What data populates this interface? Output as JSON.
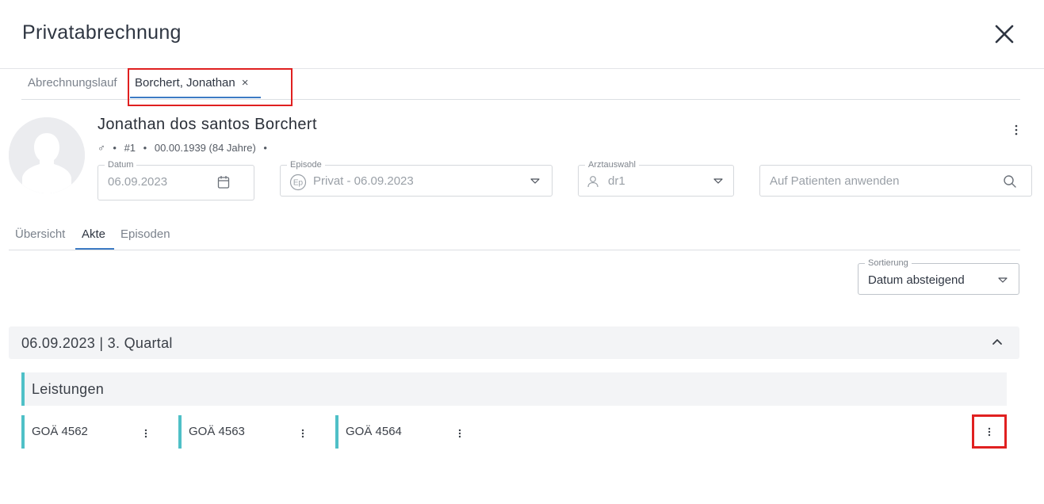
{
  "dialog": {
    "title": "Privatabrechnung"
  },
  "top_tabs": [
    {
      "label": "Abrechnungslauf"
    },
    {
      "label": "Borchert, Jonathan",
      "close": "×"
    }
  ],
  "patient": {
    "name": "Jonathan dos santos Borchert",
    "gender_symbol": "♂",
    "sep": "•",
    "number": "#1",
    "birth": "00.00.1939 (84 Jahre)"
  },
  "fields": {
    "datum": {
      "label": "Datum",
      "value": "06.09.2023",
      "icon": "calendar-icon"
    },
    "episode": {
      "label": "Episode",
      "badge": "Ep",
      "value": "Privat - 06.09.2023",
      "icon": "chevron-down-icon"
    },
    "arzt": {
      "label": "Arztauswahl",
      "value": "dr1",
      "icon": "person-icon"
    },
    "search": {
      "placeholder": "Auf Patienten anwenden",
      "icon": "search-icon"
    }
  },
  "sub_tabs": [
    {
      "label": "Übersicht"
    },
    {
      "label": "Akte",
      "active": true
    },
    {
      "label": "Episoden"
    }
  ],
  "sort": {
    "label": "Sortierung",
    "value": "Datum absteigend"
  },
  "quarter": {
    "title": "06.09.2023 | 3. Quartal"
  },
  "group": {
    "title": "Leistungen"
  },
  "services": [
    {
      "label": "GOÄ 4562"
    },
    {
      "label": "GOÄ 4563"
    },
    {
      "label": "GOÄ 4564"
    }
  ],
  "colors": {
    "accent_teal": "#4fc0c7",
    "tab_underline": "#3d7bc4",
    "highlight_red": "#e02020"
  }
}
